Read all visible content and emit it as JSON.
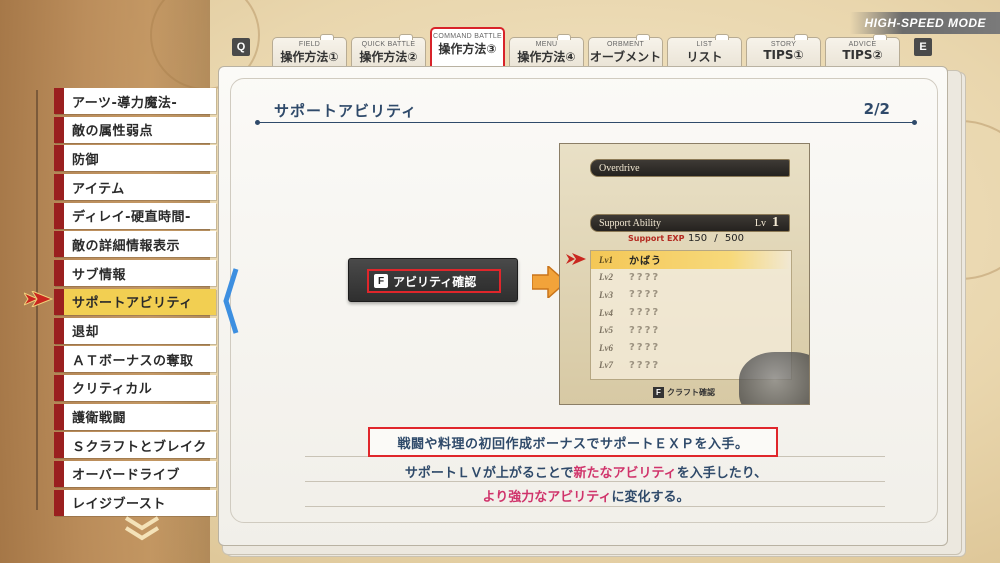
{
  "hud": {
    "mode_label": "HIGH-SPEED MODE",
    "prev_key": "Q",
    "next_key": "E"
  },
  "tabs": [
    {
      "sub": "FIELD",
      "label": "操作方法①",
      "active": false
    },
    {
      "sub": "QUICK BATTLE",
      "label": "操作方法②",
      "active": false
    },
    {
      "sub": "COMMAND BATTLE",
      "label": "操作方法③",
      "active": true
    },
    {
      "sub": "MENU",
      "label": "操作方法④",
      "active": false
    },
    {
      "sub": "ORBMENT",
      "label": "オーブメント",
      "active": false
    },
    {
      "sub": "LIST",
      "label": "リスト",
      "active": false
    },
    {
      "sub": "STORY",
      "label": "TIPS①",
      "active": false
    },
    {
      "sub": "ADVICE",
      "label": "TIPS②",
      "active": false
    }
  ],
  "sidebar": {
    "items": [
      {
        "label": "アーツ-導力魔法-"
      },
      {
        "label": "敵の属性弱点"
      },
      {
        "label": "防御"
      },
      {
        "label": "アイテム"
      },
      {
        "label": "ディレイ-硬直時間-"
      },
      {
        "label": "敵の詳細情報表示"
      },
      {
        "label": "サブ情報"
      },
      {
        "label": "サポートアビリティ"
      },
      {
        "label": "退却"
      },
      {
        "label": "ＡＴボーナスの奪取"
      },
      {
        "label": "クリティカル"
      },
      {
        "label": "護衛戦闘"
      },
      {
        "label": "Ｓクラフトとブレイク"
      },
      {
        "label": "オーバードライブ"
      },
      {
        "label": "レイジブースト"
      }
    ],
    "selected_index": 7
  },
  "content": {
    "title": "サポートアビリティ",
    "page_indicator": "2/2",
    "prompt_key": "F",
    "prompt_label": "アビリティ確認",
    "caption_line1": "戦闘や料理の初回作成ボーナスでサポートＥＸＰを入手。",
    "caption_line2_a": "サポートＬＶが上がることで",
    "caption_line2_b": "新たなアビリティ",
    "caption_line2_c": "を入手したり、",
    "caption_line3_a": "より強力なアビリティ",
    "caption_line3_b": "に変化する。"
  },
  "preview": {
    "overdrive_label": "Overdrive",
    "support_label": "Support Ability",
    "lv_label": "Lv",
    "lv_value": "1",
    "exp_label": "Support EXP",
    "exp_current": "150",
    "exp_sep": "/",
    "exp_max": "500",
    "rows": [
      {
        "lv": "Lv1",
        "name": "かばう"
      },
      {
        "lv": "Lv2",
        "name": "????"
      },
      {
        "lv": "Lv3",
        "name": "????"
      },
      {
        "lv": "Lv4",
        "name": "????"
      },
      {
        "lv": "Lv5",
        "name": "????"
      },
      {
        "lv": "Lv6",
        "name": "????"
      },
      {
        "lv": "Lv7",
        "name": "????"
      }
    ],
    "selected_row": 0,
    "craft_key": "F",
    "craft_label": "クラフト確認"
  },
  "colors": {
    "accent_red": "#e0262b",
    "menu_selected": "#f2cf52",
    "text_blue": "#2f4a6a",
    "highlight_pink": "#d0346b"
  }
}
